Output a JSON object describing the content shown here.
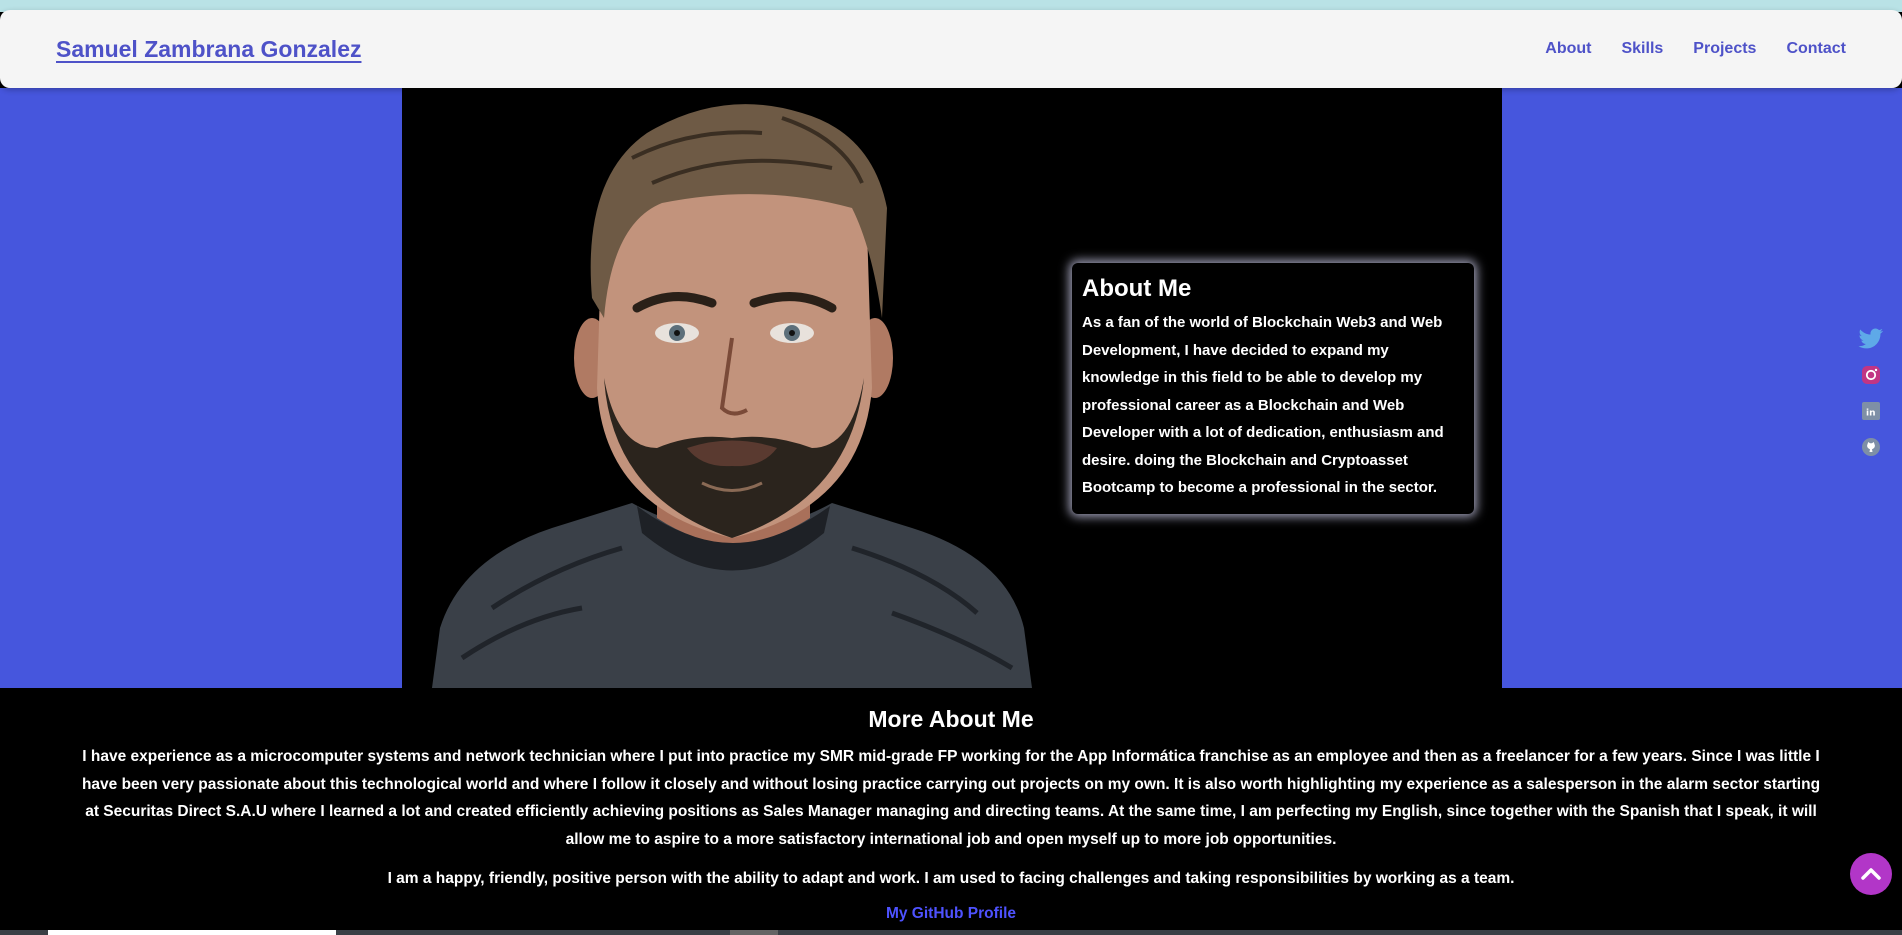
{
  "header": {
    "brand": "Samuel Zambrana Gonzalez",
    "nav": [
      "About",
      "Skills",
      "Projects",
      "Contact"
    ]
  },
  "about": {
    "title": "About Me",
    "text": "As a fan of the world of Blockchain Web3 and Web Development, I have decided to expand my knowledge in this field to be able to develop my professional career as a Blockchain and Web Developer with a lot of dedication, enthusiasm and desire. doing the Blockchain and Cryptoasset Bootcamp to become a professional in the sector."
  },
  "social": [
    "twitter-icon",
    "instagram-icon",
    "linkedin-icon",
    "github-icon"
  ],
  "more": {
    "title": "More About Me",
    "p1": "I have experience as a microcomputer systems and network technician where I put into practice my SMR mid-grade FP working for the App Informática franchise as an employee and then as a freelancer for a few years. Since I was little I have been very passionate about this technological world and where I follow it closely and without losing practice carrying out projects on my own. It is also worth highlighting my experience as a salesperson in the alarm sector starting at Securitas Direct S.A.U where I learned a lot and created efficiently achieving positions as Sales Manager managing and directing teams. At the same time, I am perfecting my English, since together with the Spanish that I speak, it will allow me to aspire to a more satisfactory international job and open myself up to more job opportunities.",
    "p2": "I am a happy, friendly, positive person with the ability to adapt and work. I am used to facing challenges and taking responsibilities by working as a team.",
    "github_link": "My GitHub Profile"
  },
  "colors": {
    "brand": "#4e52c8",
    "hero_bg": "#4656dd",
    "scroll_button": "#b236c8",
    "link": "#4e52ff"
  }
}
